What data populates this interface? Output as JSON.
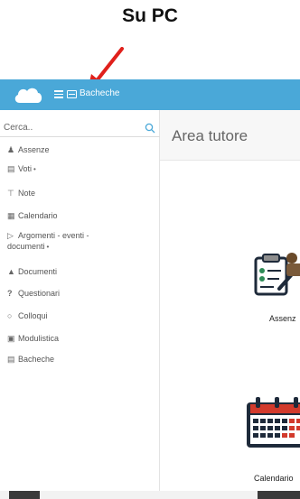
{
  "caption": "Su PC",
  "topbar": {
    "title": "Bacheche"
  },
  "search": {
    "placeholder": "Cerca.."
  },
  "sidebar": {
    "items": [
      {
        "label": "Assenze",
        "icon": "user-icon"
      },
      {
        "label": "Voti",
        "icon": "institution-icon",
        "dot": "•"
      },
      {
        "label": "Note",
        "icon": "pin-icon"
      },
      {
        "label": "Calendario",
        "icon": "calendar-icon"
      },
      {
        "label": "Argomenti - eventi -",
        "label2": "documenti",
        "icon": "folder-open-icon",
        "dot": "•"
      },
      {
        "label": "Documenti",
        "icon": "graduation-cap-icon"
      },
      {
        "label": "Questionari",
        "icon": "question-icon"
      },
      {
        "label": "Colloqui",
        "icon": "comments-icon"
      },
      {
        "label": "Modulistica",
        "icon": "briefcase-icon"
      },
      {
        "label": "Bacheche",
        "icon": "board-icon"
      }
    ]
  },
  "main": {
    "title": "Area tutore",
    "tiles": [
      {
        "label": "Assenz",
        "icon": "attendance-clipboard-icon"
      },
      {
        "label": "Calendario",
        "icon": "calendar-large-icon"
      }
    ]
  },
  "colors": {
    "topbar": "#4aa8d8",
    "arrow": "#e0201b",
    "calendar_red": "#d23a2c"
  }
}
